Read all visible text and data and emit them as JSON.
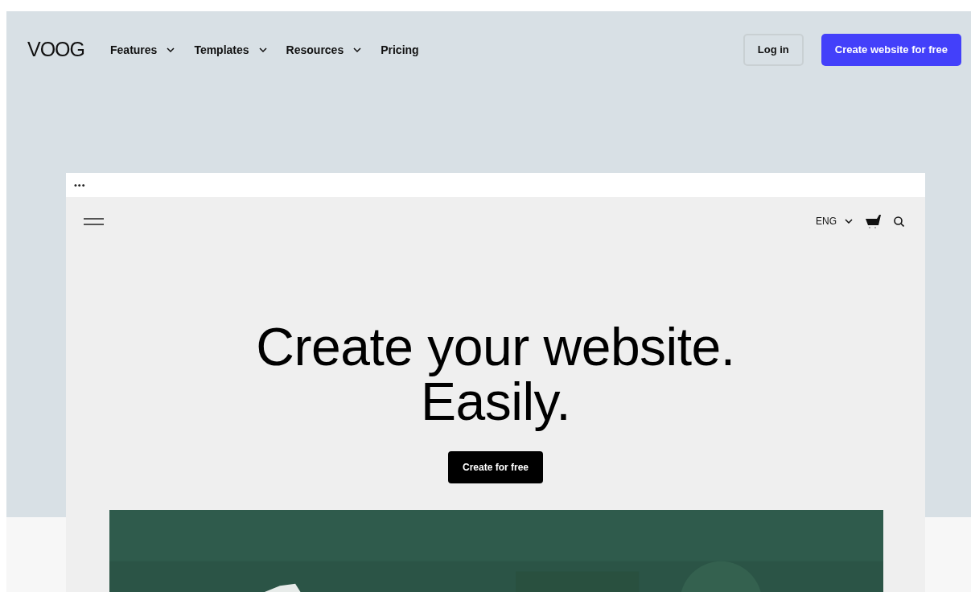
{
  "header": {
    "logo": "VOOG",
    "nav": [
      {
        "label": "Features",
        "dropdown": true
      },
      {
        "label": "Templates",
        "dropdown": true
      },
      {
        "label": "Resources",
        "dropdown": true
      },
      {
        "label": "Pricing",
        "dropdown": false
      }
    ],
    "login": "Log in",
    "cta": "Create website for free"
  },
  "preview": {
    "menu_dots": "•••",
    "language": "ENG",
    "headline": [
      "Create your website.",
      "Easily."
    ],
    "button": "Create for free"
  }
}
